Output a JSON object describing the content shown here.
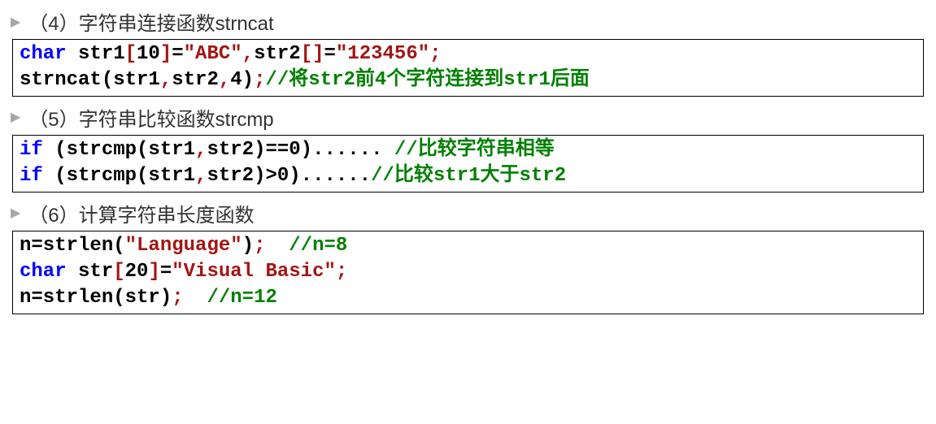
{
  "sections": [
    {
      "heading": "（4）字符串连接函数strncat",
      "code": [
        [
          {
            "cls": "kw",
            "t": "char"
          },
          {
            "cls": "plain",
            "t": " str1"
          },
          {
            "cls": "punc-br",
            "t": "["
          },
          {
            "cls": "plain",
            "t": "10"
          },
          {
            "cls": "punc-br",
            "t": "]"
          },
          {
            "cls": "plain",
            "t": "="
          },
          {
            "cls": "str",
            "t": "\"ABC\""
          },
          {
            "cls": "punc-br",
            "t": ","
          },
          {
            "cls": "plain",
            "t": "str2"
          },
          {
            "cls": "punc-br",
            "t": "[]"
          },
          {
            "cls": "plain",
            "t": "="
          },
          {
            "cls": "str",
            "t": "\"123456\""
          },
          {
            "cls": "punc-br",
            "t": ";"
          }
        ],
        [
          {
            "cls": "plain",
            "t": "strncat(str1"
          },
          {
            "cls": "punc-br",
            "t": ","
          },
          {
            "cls": "plain",
            "t": "str2"
          },
          {
            "cls": "punc-br",
            "t": ","
          },
          {
            "cls": "plain",
            "t": "4)"
          },
          {
            "cls": "punc-br",
            "t": ";"
          },
          {
            "cls": "cmt",
            "t": "//将str2前4个字符连接到str1后面"
          }
        ]
      ]
    },
    {
      "heading": "（5）字符串比较函数strcmp",
      "code": [
        [
          {
            "cls": "kw",
            "t": "if"
          },
          {
            "cls": "plain",
            "t": " (strcmp(str1"
          },
          {
            "cls": "punc-br",
            "t": ","
          },
          {
            "cls": "plain",
            "t": "str2)==0)...... "
          },
          {
            "cls": "cmt",
            "t": "//比较字符串相等"
          }
        ],
        [
          {
            "cls": "kw",
            "t": "if"
          },
          {
            "cls": "plain",
            "t": " (strcmp(str1"
          },
          {
            "cls": "punc-br",
            "t": ","
          },
          {
            "cls": "plain",
            "t": "str2)>0)......"
          },
          {
            "cls": "cmt",
            "t": "//比较str1大于str2"
          }
        ]
      ]
    },
    {
      "heading": "（6）计算字符串长度函数",
      "code": [
        [
          {
            "cls": "plain",
            "t": "n=strlen("
          },
          {
            "cls": "str",
            "t": "\"Language\""
          },
          {
            "cls": "plain",
            "t": ")"
          },
          {
            "cls": "punc-br",
            "t": ";"
          },
          {
            "cls": "plain",
            "t": "  "
          },
          {
            "cls": "cmt",
            "t": "//n=8"
          }
        ],
        [
          {
            "cls": "kw",
            "t": "char"
          },
          {
            "cls": "plain",
            "t": " str"
          },
          {
            "cls": "punc-br",
            "t": "["
          },
          {
            "cls": "plain",
            "t": "20"
          },
          {
            "cls": "punc-br",
            "t": "]"
          },
          {
            "cls": "plain",
            "t": "="
          },
          {
            "cls": "str",
            "t": "\"Visual Basic\""
          },
          {
            "cls": "punc-br",
            "t": ";"
          }
        ],
        [
          {
            "cls": "plain",
            "t": "n=strlen(str)"
          },
          {
            "cls": "punc-br",
            "t": ";"
          },
          {
            "cls": "plain",
            "t": "  "
          },
          {
            "cls": "cmt",
            "t": "//n=12"
          }
        ]
      ]
    }
  ]
}
